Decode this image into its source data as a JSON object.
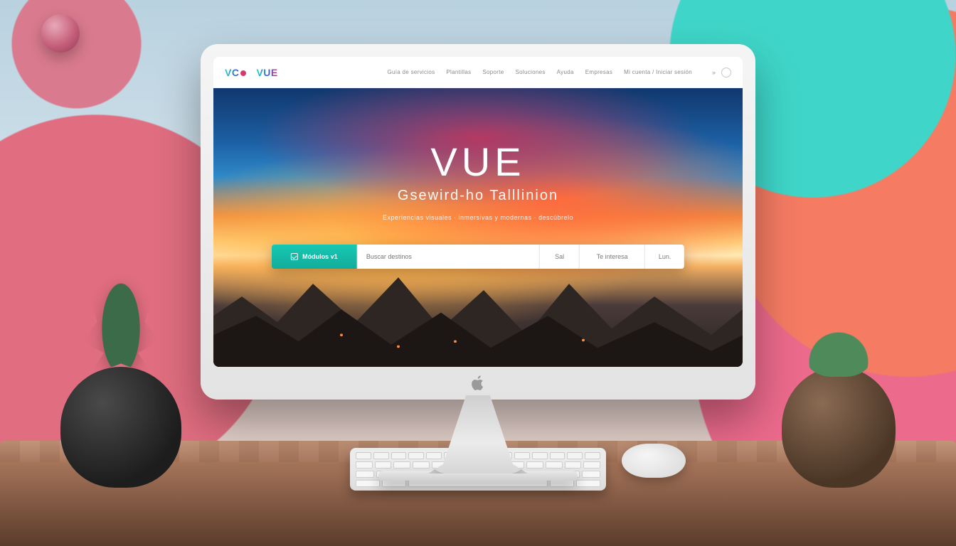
{
  "brand": {
    "primary": "VC",
    "secondary": "VUE"
  },
  "nav": {
    "items": [
      "Guía de servicios",
      "Plantillas",
      "Soporte",
      "Soluciones",
      "Ayuda",
      "Empresas",
      "Mi cuenta / Iniciar sesión"
    ],
    "tail": "»"
  },
  "hero": {
    "title": "VUE",
    "subtitle": "Gsewird-ho Talllinion",
    "tagline": "Experiencias visuales · inmersivas y modernas · descúbrelo"
  },
  "search": {
    "primary_label": "Módulos v1",
    "main_placeholder": "Buscar destinos",
    "seg_small": "Sal",
    "seg_med": "Te interesa",
    "seg_last": "Lun."
  },
  "colors": {
    "accent_teal": "#17c8b3",
    "accent_pink": "#d43b6c",
    "accent_blue": "#2b6bd4"
  }
}
